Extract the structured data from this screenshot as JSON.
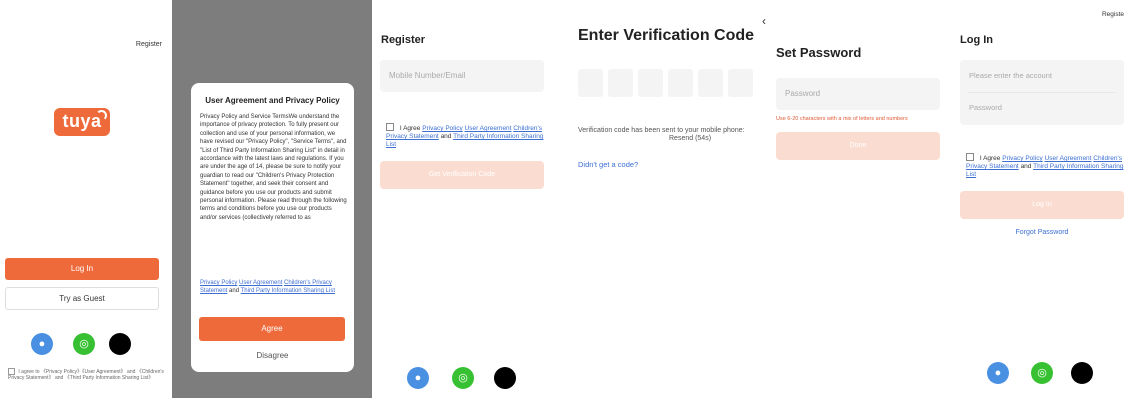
{
  "screens": {
    "welcome": {
      "register": "Register",
      "logo_text": "tuya",
      "login_button": "Log In",
      "guest_button": "Try as Guest",
      "agreement": "I agree to 《Privacy Policy》《User Agreement》 and 《Children's Privacy Statement》 and 《Third Party Information Sharing List》"
    },
    "privacy_modal": {
      "title": "User Agreement and Privacy Policy",
      "body": "Privacy Policy and Service TermsWe understand the importance of privacy protection. To fully present our collection and use of your personal information, we have revised our \"Privacy Policy\", \"Service Terms\", and \"List of Third Party Information Sharing List\" in detail in accordance with the latest laws and regulations. If you are under the age of 14, please be sure to notify your guardian to read our \"Children's Privacy Protection Statement\" together, and seek their consent and guidance before you use our products and submit personal information. Please read through the following terms and conditions before you use our products and/or services (collectively referred to as",
      "link1": "Privacy Policy",
      "link2": "User Agreement",
      "link3": "Children's Privacy Statement",
      "and": "and",
      "link4": "Third Party Information Sharing List",
      "agree_button": "Agree",
      "disagree": "Disagree"
    },
    "register": {
      "title": "Register",
      "input_placeholder": "Mobile Number/Email",
      "agree_prefix": "I Agree",
      "link1": "Privacy Policy",
      "link2": "User Agreement",
      "link3": "Children's Privacy Statement",
      "and": "and",
      "link4": "Third Party Information Sharing List",
      "button": "Get Verification Code"
    },
    "verification": {
      "title": "Enter Verification Code",
      "sent_text": "Verification code has been sent to your mobile phone:",
      "resend": "Resend (54s)",
      "didnt_get": "Didn't get a code?"
    },
    "set_password": {
      "back": "‹",
      "title": "Set Password",
      "input_placeholder": "Password",
      "hint": "Use 6-20 characters with a mix of letters and numbers",
      "button": "Done"
    },
    "login": {
      "back": "‹",
      "register": "Registe",
      "title": "Log In",
      "account_placeholder": "Please enter the account",
      "password_placeholder": "Password",
      "agree_prefix": "I Agree",
      "link1": "Privacy Policy",
      "link2": "User Agreement",
      "link3": "Children's Privacy Statement",
      "and": "and",
      "link4": "Third Party Information Sharing List",
      "button": "Log In",
      "forgot": "Forgot Password"
    }
  },
  "icons": {
    "qq": "qq-icon",
    "wechat": "wechat-icon",
    "apple": "apple-icon"
  },
  "colors": {
    "accent": "#ee6a3a",
    "accent_disabled": "#fbdcd0",
    "link": "#3d6fd3",
    "overlay": "#7d7d7d"
  }
}
